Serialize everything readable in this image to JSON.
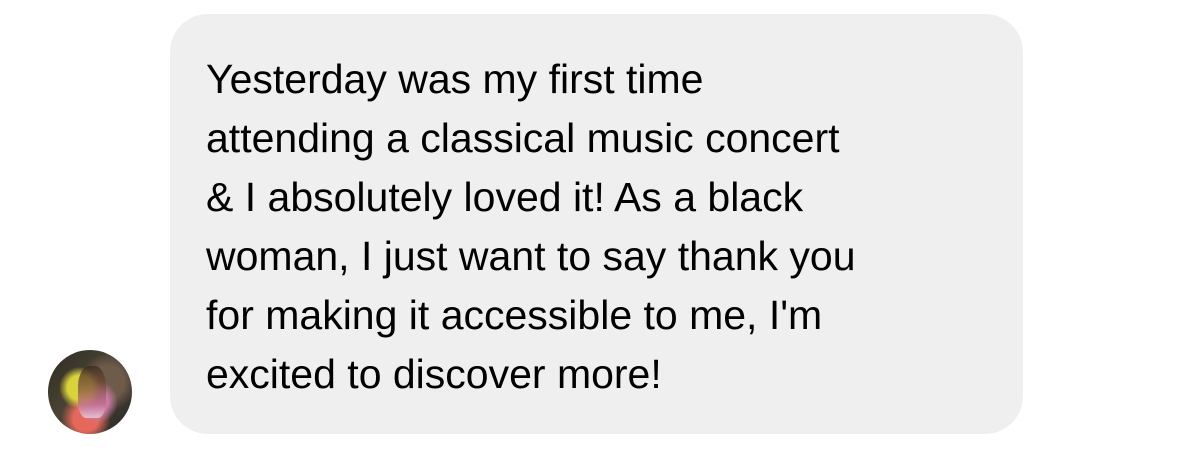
{
  "message": {
    "text": "Yesterday was my first time\nattending a classical music concert\n& I absolutely loved it! As a black\nwoman, I just want to say thank you\nfor making it accessible to me, I'm\nexcited to discover more!"
  },
  "colors": {
    "bubble_background": "#efefef",
    "text": "#000000",
    "page_background": "#ffffff"
  }
}
